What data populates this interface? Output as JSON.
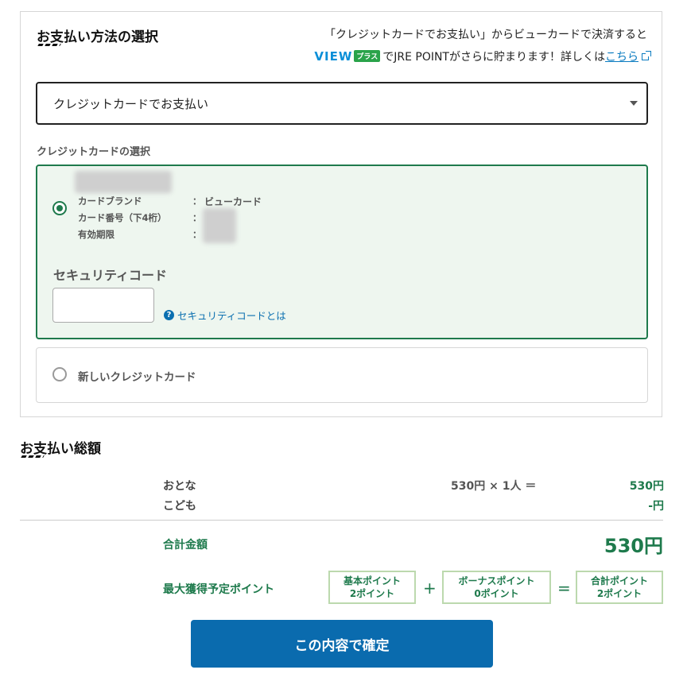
{
  "payment_method": {
    "title": "お支払い方法の選択",
    "promo_line1": "「クレジットカードでお支払い」からビューカードで決済すると",
    "view_logo": "VIEW",
    "plus_badge": "プラス",
    "promo_line2": "でJRE POINTがさらに貯まります！詳しくは",
    "promo_link": "こちら",
    "selected_method": "クレジットカードでお支払い",
    "card_section_label": "クレジットカードの選択",
    "saved_card": {
      "brand_key": "カードブランド",
      "brand_value": "ビューカード",
      "number_key": "カード番号（下4桁）",
      "expiry_key": "有効期限",
      "colon": "：",
      "selected": true
    },
    "security_code_label": "セキュリティコード",
    "security_code_value": "",
    "security_help": "セキュリティコードとは",
    "new_card_label": "新しいクレジットカード"
  },
  "total": {
    "title": "お支払い総額",
    "adult_label": "おとな",
    "adult_calc": "530円 × 1人 ＝",
    "adult_amount": "530円",
    "child_label": "こども",
    "child_amount": "-円",
    "total_label": "合計金額",
    "total_amount": "530円",
    "points_label": "最大獲得予定ポイント",
    "basic_points_title": "基本ポイント",
    "basic_points_value": "2ポイント",
    "plus_sign": "+",
    "bonus_points_title": "ボーナスポイント",
    "bonus_points_value": "0ポイント",
    "equals_sign": "=",
    "total_points_title": "合計ポイント",
    "total_points_value": "2ポイント"
  },
  "confirm_button": "この内容で確定",
  "colors": {
    "accent_green": "#1e7a4c",
    "button_blue": "#0a6bae",
    "link_blue": "#0a6fb0"
  }
}
